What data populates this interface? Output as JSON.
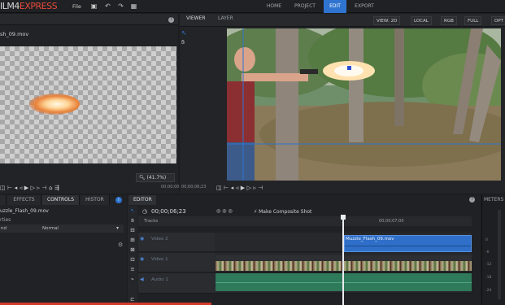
{
  "app": {
    "logo_text": "ILM4",
    "logo_accent": "EXPRESS",
    "file_menu": "File",
    "nav_tabs": [
      "HOME",
      "PROJECT",
      "EDIT",
      "EXPORT"
    ],
    "active_tab": "EDIT"
  },
  "media_panel": {
    "filename": "sh_09.mov",
    "zoom": "(41.7%)",
    "timecode": "00;00;00;17"
  },
  "viewer": {
    "tabs": [
      "VIEWER",
      "LAYER"
    ],
    "active_tab": "VIEWER",
    "options": [
      "VIEW: 2D",
      "LOCAL",
      "RGB",
      "FULL",
      "OPT"
    ],
    "timecode": "00;00;06;23"
  },
  "controls_panel": {
    "tabs": [
      "",
      "EFFECTS",
      "CONTROLS",
      "HISTOR"
    ],
    "active_tab": "CONTROLS",
    "file": "uzzle_Flash_09.mov",
    "properties_label": "rties",
    "row_left": "nd",
    "row_value": "Normal"
  },
  "editor": {
    "tab": "EDITOR",
    "timecode": "00;00;06;23",
    "composite_label": "Make Composite Shot",
    "tracks_label": "Tracks",
    "ruler_time": "00;00;07;00",
    "tracks": [
      {
        "name": "Video 2"
      },
      {
        "name": "Video 1"
      },
      {
        "name": "Audio 1"
      }
    ],
    "clip_flash_name": "Muzzle_Flash_09.mov"
  },
  "meters": {
    "title": "METERS",
    "labels": [
      "0",
      "-6",
      "-12",
      "-18",
      "-24"
    ]
  },
  "colors": {
    "accent_blue": "#2f74d0",
    "logo_red": "#e84a3a",
    "progress_red": "#d23a2a"
  }
}
